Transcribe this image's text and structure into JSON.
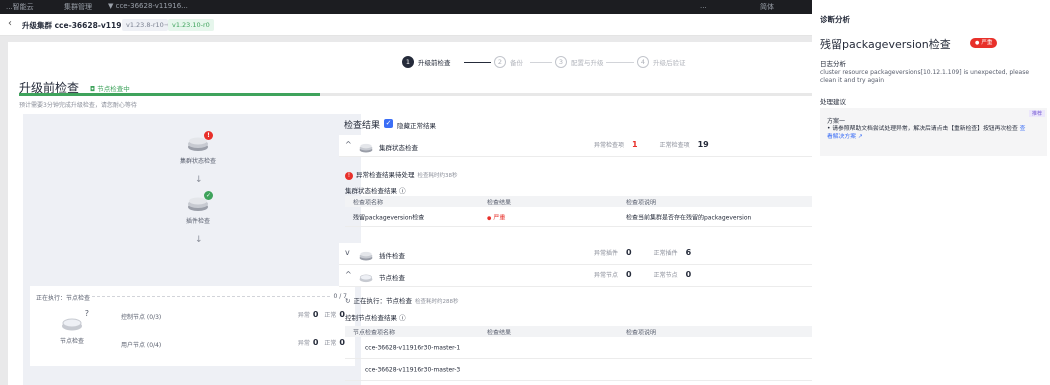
{
  "topbar": {
    "item1": "...智能云",
    "item2": "集群管理",
    "item3": "▼ cce-36628-v11916...",
    "right1": "...",
    "right2": "简体"
  },
  "cluster": {
    "back_icon": "chevron-left",
    "title": "升级集群 cce-36628-v1191...",
    "from_version": "v1.23.8-r10",
    "arrow": "→",
    "to_version": "v1.23.10-r0"
  },
  "stepper": {
    "steps": [
      {
        "num": "1",
        "label": "升级前检查"
      },
      {
        "num": "2",
        "label": "备份"
      },
      {
        "num": "3",
        "label": "配置与升级"
      },
      {
        "num": "4",
        "label": "升级后验证"
      }
    ]
  },
  "header": {
    "title": "升级前检查",
    "status": "节点检查中",
    "subtitle": "预计需要3分钟完成升级检查，请您耐心等待",
    "progress_percent": 38
  },
  "left_panel": {
    "cluster_check": "集群状态检查",
    "cluster_badge": "!",
    "component_check": "插件检查",
    "node_check": "节点检查",
    "node_badge": "?",
    "executing": "正在执行：节点检查",
    "progress_count": "0 / 7",
    "master_nodes": "控制节点 (0/3)",
    "user_nodes": "用户节点 (0/4)",
    "abnormal_label": "异常",
    "normal_label": "正常",
    "master_abnormal": "0",
    "master_normal": "0",
    "user_abnormal": "0",
    "user_normal": "0"
  },
  "results": {
    "title": "检查结果",
    "hide_normal": "隐藏正常结果",
    "sections": {
      "cluster": {
        "name": "集群状态检查",
        "abnormal_label": "异常检查项",
        "abnormal": "1",
        "normal_label": "正常检查项",
        "normal": "19"
      },
      "component": {
        "name": "插件检查",
        "abnormal_label": "异常插件",
        "abnormal": "0",
        "normal_label": "正常插件",
        "normal": "6"
      },
      "node": {
        "name": "节点检查",
        "abnormal_label": "异常节点",
        "abnormal": "0",
        "normal_label": "正常节点",
        "normal": "0"
      }
    },
    "warning": "异常检查结果待处理",
    "warning_time": "检查耗时约38秒",
    "cluster_result_title": "集群状态检查结果 ⓘ",
    "table1": {
      "headers": [
        "检查项名称",
        "检查结果",
        "检查项说明"
      ],
      "rows": [
        {
          "name": "残留packageversion检查",
          "result": "严重",
          "desc": "检查当前集群是否存在残留的packageversion"
        }
      ]
    },
    "executing": "正在执行：节点检查",
    "executing_time": "检查耗时约288秒",
    "node_result_title": "控制节点检查结果 ⓘ",
    "table2": {
      "headers": [
        "节点检查项名称",
        "检查结果",
        "检查项说明"
      ],
      "rows": [
        {
          "name": "cce-36628-v11916r30-master-1"
        },
        {
          "name": "cce-36628-v11916r30-master-3"
        }
      ]
    }
  },
  "diag": {
    "heading": "诊断分析",
    "title": "残留packageversion检查",
    "severity": "严重",
    "log_title": "日志分析",
    "log_text": "cluster resource packageversions[10.12.1.109] is unexpected, please clean it and try again",
    "advice_title": "处理建议",
    "card_tag": "推荐",
    "plan": "方案一",
    "plan_text": "• 请参照帮助文档尝试处理异常，解决后请点击【重新检查】按钮再次检查",
    "link": "查看解决方案 ↗"
  },
  "colors": {
    "accent": "#3b6ef6",
    "danger": "#e8302a",
    "success": "#3fa35c"
  }
}
